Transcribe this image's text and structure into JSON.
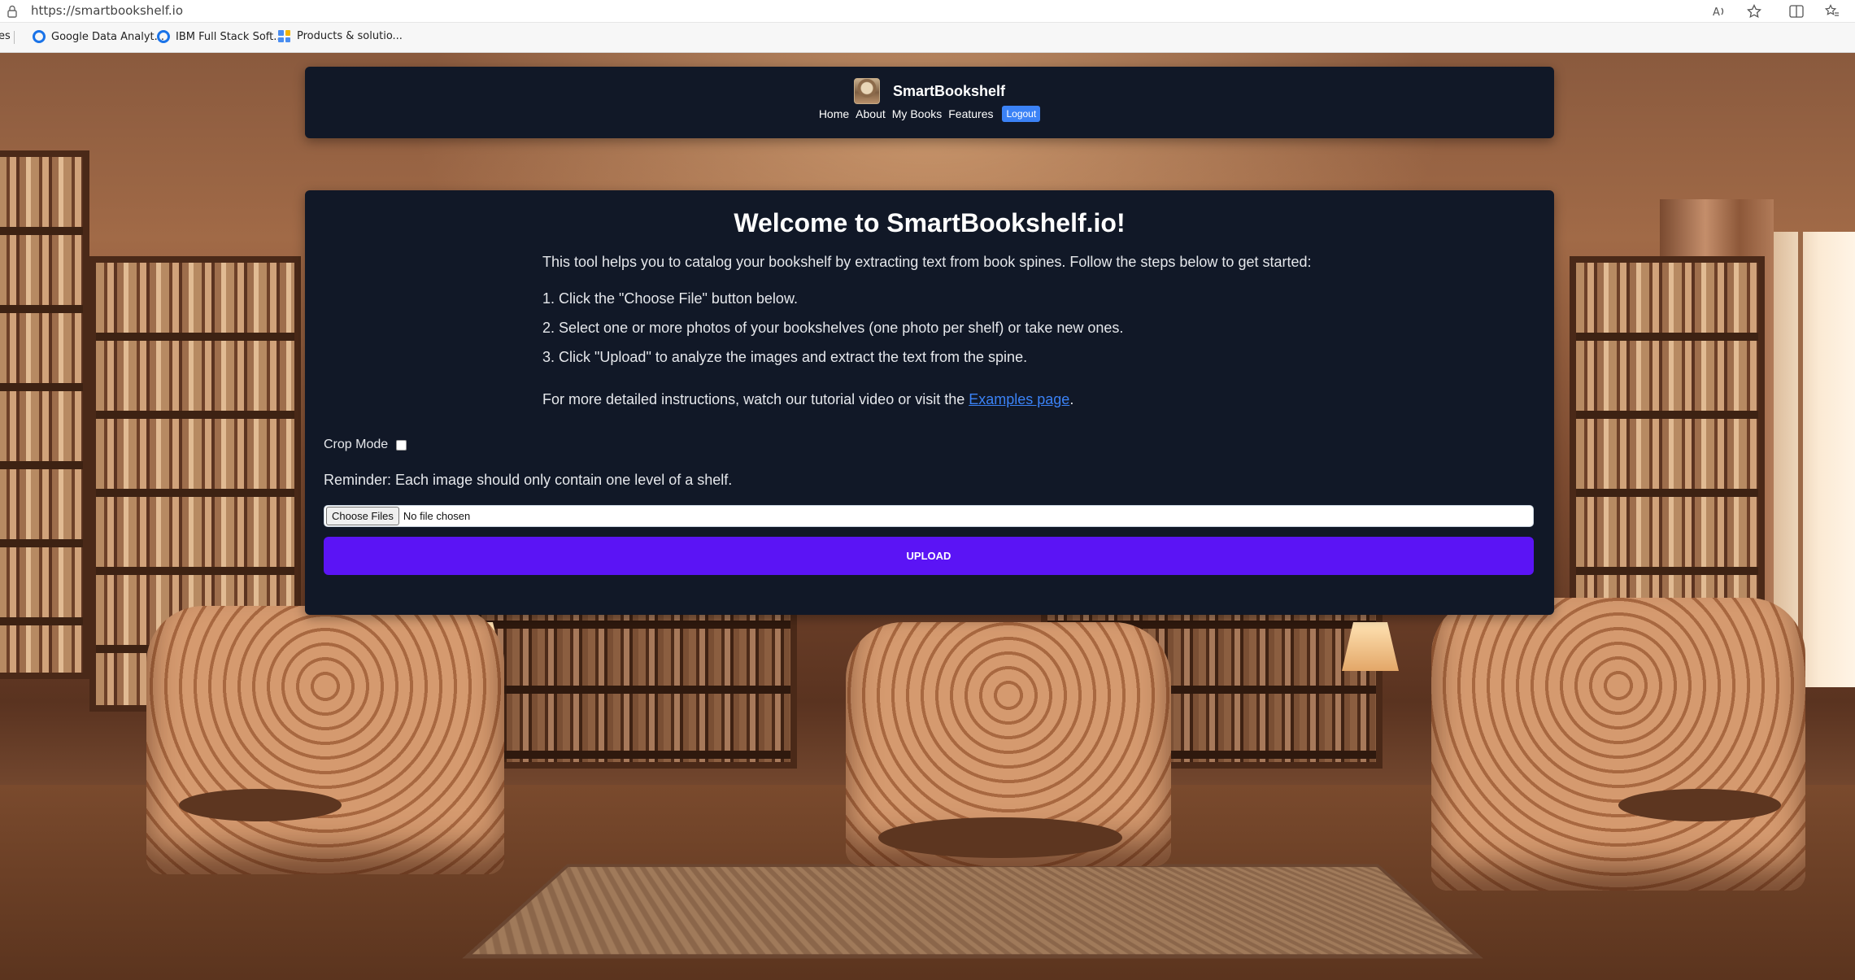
{
  "browser": {
    "url": "https://smartbookshelf.io",
    "bookmarks": [
      {
        "label": "es",
        "icon": "folder-icon"
      },
      {
        "label": "Google Data Analyt...",
        "icon": "google-icon"
      },
      {
        "label": "IBM Full Stack Soft...",
        "icon": "google-icon"
      },
      {
        "label": "Products & solutio...",
        "icon": "grid-icon"
      }
    ]
  },
  "nav": {
    "brand": "SmartBookshelf",
    "links": [
      "Home",
      "About",
      "My Books",
      "Features"
    ],
    "logout": "Logout"
  },
  "main": {
    "title": "Welcome to SmartBookshelf.io!",
    "intro": "This tool helps you to catalog your bookshelf by extracting text from book spines. Follow the steps below to get started:",
    "steps": [
      "1. Click the \"Choose File\" button below.",
      "2. Select one or more photos of your bookshelves (one photo per shelf) or take new ones.",
      "3. Click \"Upload\" to analyze the images and extract the text from the spine."
    ],
    "more_prefix": "For more detailed instructions, watch our tutorial video or visit the ",
    "more_link": "Examples page",
    "more_suffix": ".",
    "crop_label": "Crop Mode",
    "crop_checked": false,
    "reminder": "Reminder: Each image should only contain one level of a shelf.",
    "choose_files": "Choose Files",
    "file_status": "No file chosen",
    "upload": "UPLOAD"
  },
  "colors": {
    "panel": "#111827",
    "upload": "#5b14f5",
    "link": "#3b82f6"
  }
}
